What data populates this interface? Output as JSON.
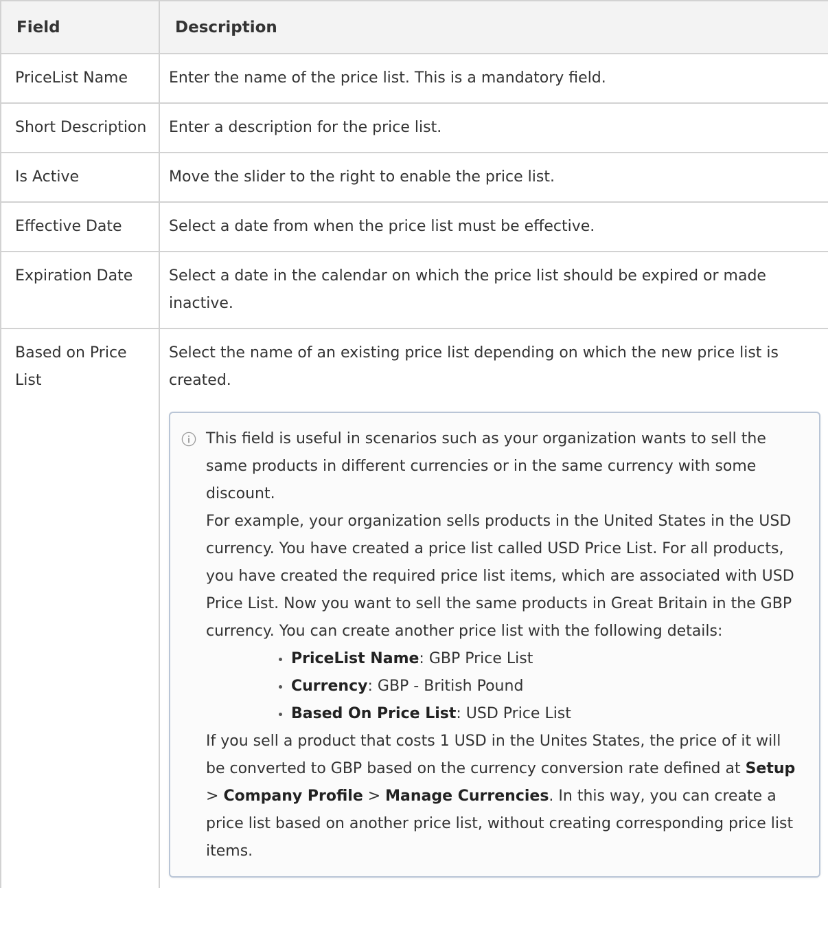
{
  "table": {
    "headers": [
      "Field",
      "Description"
    ],
    "rows": [
      {
        "field": "PriceList Name",
        "description": "Enter the name of the price list. This is a mandatory field."
      },
      {
        "field": "Short Description",
        "description": "Enter a description for the price list."
      },
      {
        "field": "Is Active",
        "description": "Move the slider to the right to enable the price list."
      },
      {
        "field": "Effective Date",
        "description": "Select a date from when the price list must be effective."
      },
      {
        "field": "Expiration Date",
        "description": "Select a date in the calendar on which the price list should be expired or made inactive."
      },
      {
        "field": "Based on Price List",
        "description": "Select the name of an existing price list depending on which the new price list is created."
      }
    ]
  },
  "note": {
    "icon": "info-icon",
    "intro": "This field is useful in scenarios such as your organization wants to sell the same products in different currencies or in the same currency with some discount.",
    "example": "For example, your organization sells products in the United States in the USD currency. You have created a price list called USD Price List. For all products, you have created the required price list items, which are associated with USD Price List. Now you want to sell the same products in Great Britain in the GBP currency. You can create another price list with the following details:",
    "details": [
      {
        "label": "PriceList Name",
        "value": ": GBP Price List"
      },
      {
        "label": "Currency",
        "value": ": GBP - British Pound"
      },
      {
        "label": "Based On Price List",
        "value": ": USD Price List"
      }
    ],
    "conclusion_pre": "If you sell a product that costs 1 USD in the Unites States, the price of it will be converted to GBP based on the currency conversion rate defined at ",
    "path": [
      "Setup",
      "Company Profile",
      "Manage Currencies"
    ],
    "path_separator": " > ",
    "conclusion_post": ". In this way, you can create a price list based on another price list, without creating corresponding price list items.",
    "border_color": "#b9c5d6"
  }
}
